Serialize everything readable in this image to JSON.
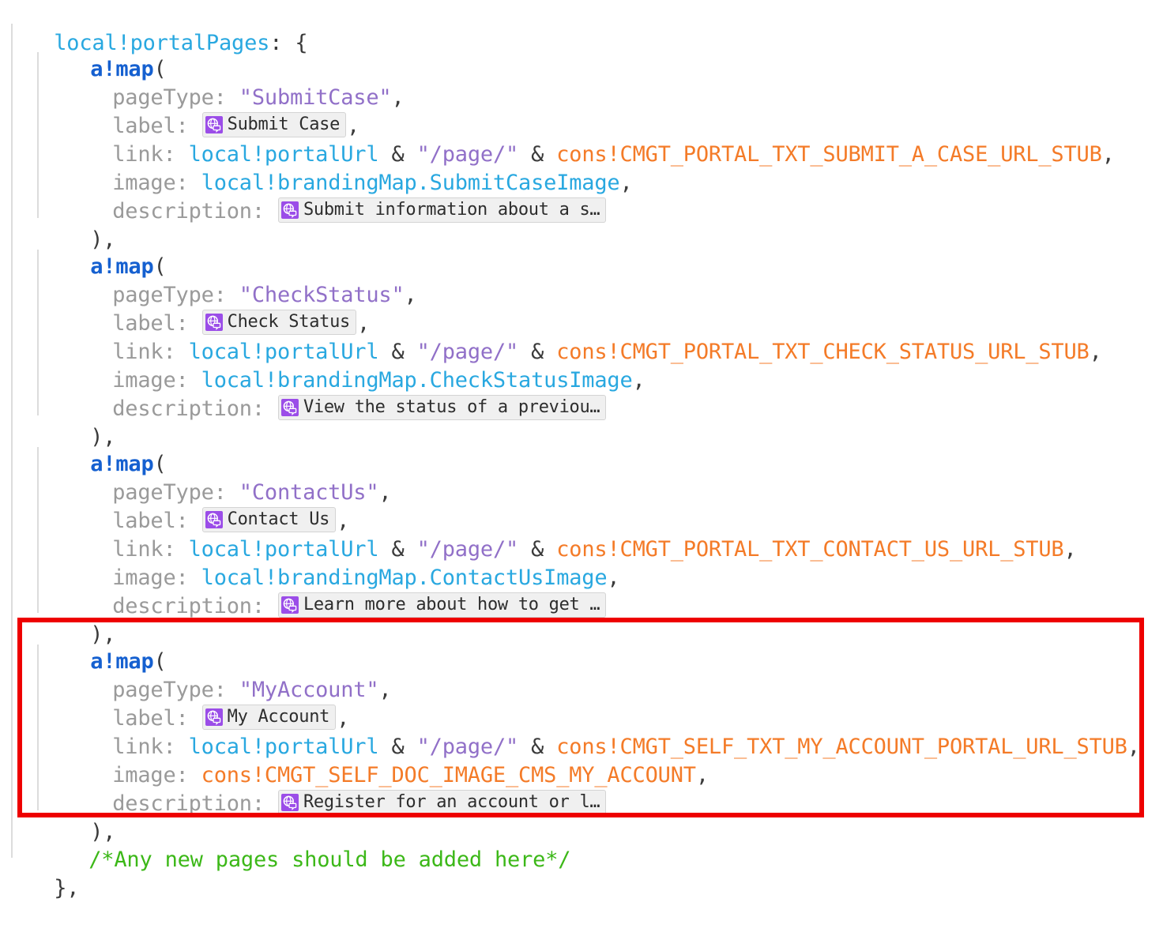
{
  "editor": {
    "language": "Appian SAIL",
    "colors": {
      "background": "#ffffff",
      "key": "#9a9a9a",
      "local_variable": "#29a8e0",
      "function": "#1560d0",
      "string": "#9170c8",
      "constant": "#f47b28",
      "comment": "#3cb818",
      "punctuation": "#3b3b3b",
      "indent_guide": "#dcdcdc",
      "chip_background": "#f0f0f0",
      "chip_border": "#d4d4d4",
      "chip_icon": "#9b4de8",
      "highlight_box": "#ee0000"
    },
    "icons": {
      "translation_chip": "globe-translation-icon"
    }
  },
  "code": {
    "root_key": "local!portalPages",
    "root_open": "{",
    "root_close": "},",
    "function_name": "a!map",
    "open_paren": "(",
    "close_paren_comma": "),",
    "keys": {
      "pageType": "pageType:",
      "label": "label:",
      "link": "link:",
      "image": "image:",
      "description": "description:"
    },
    "link_prefix_var": "local!portalUrl",
    "link_amp": "&",
    "link_page_literal": "\"/page/\"",
    "comma": ",",
    "comment": "/*Any new pages should be added here*/"
  },
  "blocks": [
    {
      "id": "submit-case",
      "highlighted": false,
      "pageType": "\"SubmitCase\"",
      "label_chip": "Submit Case",
      "link_constant": "cons!CMGT_PORTAL_TXT_SUBMIT_A_CASE_URL_STUB",
      "image_kind": "local",
      "image_value": "local!brandingMap.SubmitCaseImage",
      "description_chip": "Submit information about a s…"
    },
    {
      "id": "check-status",
      "highlighted": false,
      "pageType": "\"CheckStatus\"",
      "label_chip": "Check Status",
      "link_constant": "cons!CMGT_PORTAL_TXT_CHECK_STATUS_URL_STUB",
      "image_kind": "local",
      "image_value": "local!brandingMap.CheckStatusImage",
      "description_chip": "View the status of a previou…"
    },
    {
      "id": "contact-us",
      "highlighted": false,
      "pageType": "\"ContactUs\"",
      "label_chip": "Contact Us",
      "link_constant": "cons!CMGT_PORTAL_TXT_CONTACT_US_URL_STUB",
      "image_kind": "local",
      "image_value": "local!brandingMap.ContactUsImage",
      "description_chip": "Learn more about how to get …"
    },
    {
      "id": "my-account",
      "highlighted": true,
      "pageType": "\"MyAccount\"",
      "label_chip": "My Account",
      "link_constant": "cons!CMGT_SELF_TXT_MY_ACCOUNT_PORTAL_URL_STUB",
      "image_kind": "constant",
      "image_value": "cons!CMGT_SELF_DOC_IMAGE_CMS_MY_ACCOUNT",
      "description_chip": "Register for an account or l…"
    }
  ]
}
